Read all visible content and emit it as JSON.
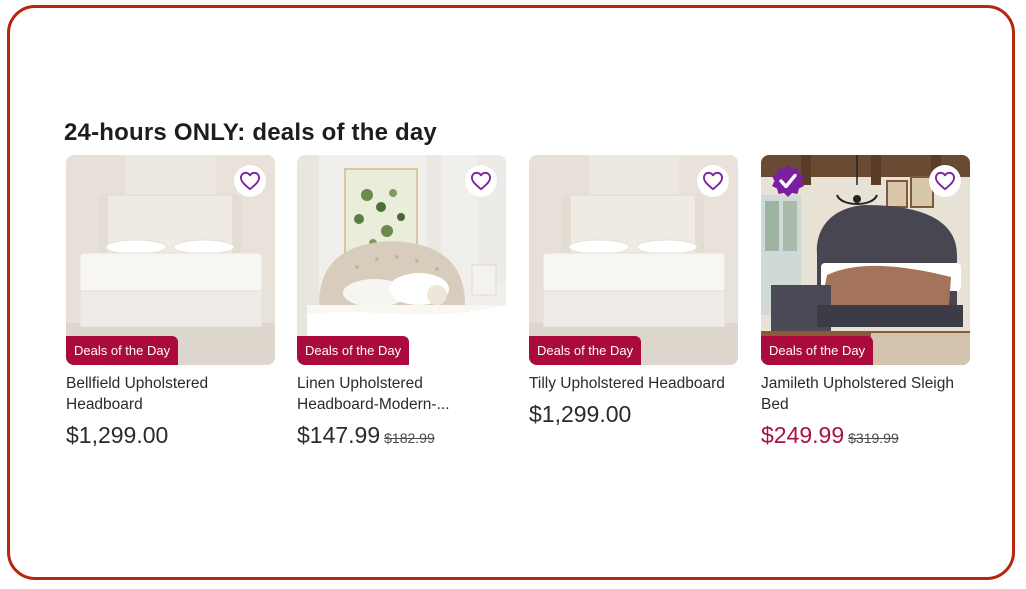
{
  "section": {
    "title": "24-hours ONLY: deals of the day"
  },
  "colors": {
    "frame_border": "#b5260c",
    "deal_badge": "#aa0a3c",
    "sale_price": "#a8123e",
    "heart": "#7b1fa2",
    "verified_badge": "#7b1fa2"
  },
  "products": [
    {
      "name": "Bellfield Upholstered Headboard",
      "badge": "Deals of the Day",
      "price": "$1,299.00",
      "was_price": "",
      "favorite_icon": "heart-icon"
    },
    {
      "name": "Linen Upholstered Headboard-Modern-...",
      "badge": "Deals of the Day",
      "price": "$147.99",
      "was_price": "$182.99",
      "favorite_icon": "heart-icon"
    },
    {
      "name": "Tilly Upholstered Headboard",
      "badge": "Deals of the Day",
      "price": "$1,299.00",
      "was_price": "",
      "favorite_icon": "heart-icon"
    },
    {
      "name": "Jamileth Upholstered Sleigh Bed",
      "badge": "Deals of the Day",
      "price": "$249.99",
      "was_price": "$319.99",
      "favorite_icon": "heart-icon",
      "verified_icon": "verified-check-icon"
    }
  ]
}
